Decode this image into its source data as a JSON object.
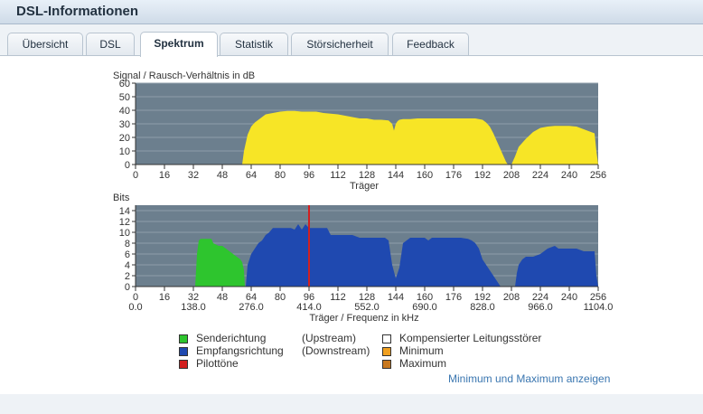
{
  "window": {
    "title": "DSL-Informationen"
  },
  "tabs": [
    {
      "label": "Übersicht",
      "active": false
    },
    {
      "label": "DSL",
      "active": false
    },
    {
      "label": "Spektrum",
      "active": true
    },
    {
      "label": "Statistik",
      "active": false
    },
    {
      "label": "Störsicherheit",
      "active": false
    },
    {
      "label": "Feedback",
      "active": false
    }
  ],
  "colors": {
    "snr_fill": "#f7e526",
    "upstream": "#2ec52e",
    "downstream": "#1f49b0",
    "pilot": "#d22020",
    "noise_marker": "#ffffff",
    "minimum": "#f0a020",
    "maximum": "#c8781e",
    "plot_background": "#6c7f8e"
  },
  "chart_data": [
    {
      "type": "area",
      "ylabel": "Signal / Rausch-Verhältnis in dB",
      "xlabel": "Träger",
      "ylim": [
        0,
        60
      ],
      "xlim": [
        0,
        256
      ],
      "yticks": [
        0,
        10,
        20,
        30,
        40,
        50,
        60
      ],
      "xticks": [
        0,
        16,
        32,
        48,
        64,
        80,
        96,
        112,
        128,
        144,
        160,
        176,
        192,
        208,
        224,
        240,
        256
      ],
      "grid": true,
      "series": [
        {
          "x": [
            59,
            60,
            62,
            64,
            66,
            68,
            70,
            72,
            76,
            80,
            84,
            88,
            92,
            96,
            100,
            104,
            108,
            112,
            116,
            120,
            124,
            128,
            132,
            136,
            140,
            142,
            143,
            144,
            145,
            146,
            148,
            152,
            156,
            160,
            164,
            168,
            172,
            176,
            180,
            184,
            188,
            192,
            194,
            196,
            198,
            200,
            202,
            204,
            205,
            206,
            208,
            210,
            212,
            216,
            220,
            224,
            228,
            232,
            236,
            240,
            244,
            248,
            252,
            254,
            255,
            256
          ],
          "y": [
            0,
            10,
            22,
            28,
            31,
            33,
            35,
            37,
            38,
            39,
            39.5,
            39.5,
            39,
            39,
            39,
            38,
            37.5,
            37,
            36,
            35,
            34,
            34,
            33,
            33,
            32.5,
            30,
            25,
            30,
            32,
            33,
            33.5,
            33.5,
            34,
            34,
            34,
            34,
            34,
            34,
            34,
            34,
            34,
            33,
            31,
            28,
            23,
            17,
            11,
            5,
            2,
            0,
            0,
            6,
            13,
            19,
            24,
            27,
            28,
            28.5,
            28.5,
            28.5,
            28,
            26,
            24,
            23,
            10,
            0
          ]
        }
      ]
    },
    {
      "type": "area",
      "ylabel": "Bits",
      "xlabel": "Träger / Frequenz in kHz",
      "ylim": [
        0,
        15
      ],
      "xlim": [
        0,
        256
      ],
      "yticks": [
        0,
        2,
        4,
        6,
        8,
        10,
        12,
        14
      ],
      "xticks": [
        0,
        16,
        32,
        48,
        64,
        80,
        96,
        112,
        128,
        144,
        160,
        176,
        192,
        208,
        224,
        240,
        256
      ],
      "freq_ticks": [
        {
          "carrier": 0,
          "label": "0.0"
        },
        {
          "carrier": 32,
          "label": "138.0"
        },
        {
          "carrier": 64,
          "label": "276.0"
        },
        {
          "carrier": 96,
          "label": "414.0"
        },
        {
          "carrier": 128,
          "label": "552.0"
        },
        {
          "carrier": 160,
          "label": "690.0"
        },
        {
          "carrier": 192,
          "label": "828.0"
        },
        {
          "carrier": 224,
          "label": "966.0"
        },
        {
          "carrier": 256,
          "label": "1104.0"
        }
      ],
      "grid": true,
      "pilot_carrier": 96,
      "series": [
        {
          "name": "Senderichtung (Upstream)",
          "x": [
            33,
            34,
            35,
            36,
            40,
            42,
            43,
            46,
            48,
            50,
            52,
            54,
            56,
            58,
            59,
            60,
            60.5
          ],
          "y": [
            0,
            6,
            8.5,
            8.8,
            8.8,
            8.8,
            8,
            7.5,
            7.5,
            7,
            6.5,
            6,
            5.5,
            5,
            4.5,
            3,
            0
          ]
        },
        {
          "name": "Empfangsrichtung (Downstream)",
          "x": [
            61,
            62,
            64,
            66,
            68,
            70,
            72,
            74,
            76,
            78,
            80,
            86,
            88,
            90,
            92,
            94,
            96,
            100,
            104,
            106,
            108,
            112,
            116,
            120,
            124,
            128,
            132,
            136,
            138,
            140,
            142,
            144,
            146,
            148,
            150,
            152,
            156,
            160,
            162,
            164,
            168,
            172,
            176,
            180,
            184,
            186,
            188,
            190,
            192,
            194,
            196,
            198,
            200,
            202,
            204,
            206,
            208,
            210,
            211,
            212,
            214,
            216,
            220,
            224,
            228,
            232,
            234,
            236,
            240,
            244,
            248,
            252,
            254,
            255,
            256
          ],
          "y": [
            0,
            4,
            6,
            7,
            8,
            8.5,
            9.5,
            10,
            10.8,
            10.8,
            10.8,
            10.8,
            10.5,
            11.5,
            10.5,
            11.5,
            10.8,
            10.8,
            10.8,
            10.8,
            9.5,
            9.5,
            9.5,
            9.5,
            9,
            9,
            9,
            9,
            9,
            8.5,
            4,
            1.5,
            3.5,
            8,
            8.5,
            9,
            9,
            9,
            8.5,
            9,
            9,
            9,
            9,
            9,
            8.8,
            8.5,
            8,
            7,
            5,
            4,
            3,
            2,
            1,
            0,
            0,
            0,
            0,
            0,
            2.5,
            4,
            5,
            5.5,
            5.5,
            6,
            7,
            7.5,
            7,
            7,
            7,
            7,
            6.5,
            6.5,
            6.5,
            2,
            0
          ]
        }
      ]
    }
  ],
  "legend": {
    "upstream_label": "Senderichtung",
    "upstream_note": "(Upstream)",
    "downstream_label": "Empfangsrichtung",
    "downstream_note": "(Downstream)",
    "pilot_label": "Pilottöne",
    "noise_label": "Kompensierter Leitungsstörer",
    "minimum_label": "Minimum",
    "maximum_label": "Maximum"
  },
  "links": {
    "show_minmax": "Minimum und Maximum anzeigen"
  }
}
